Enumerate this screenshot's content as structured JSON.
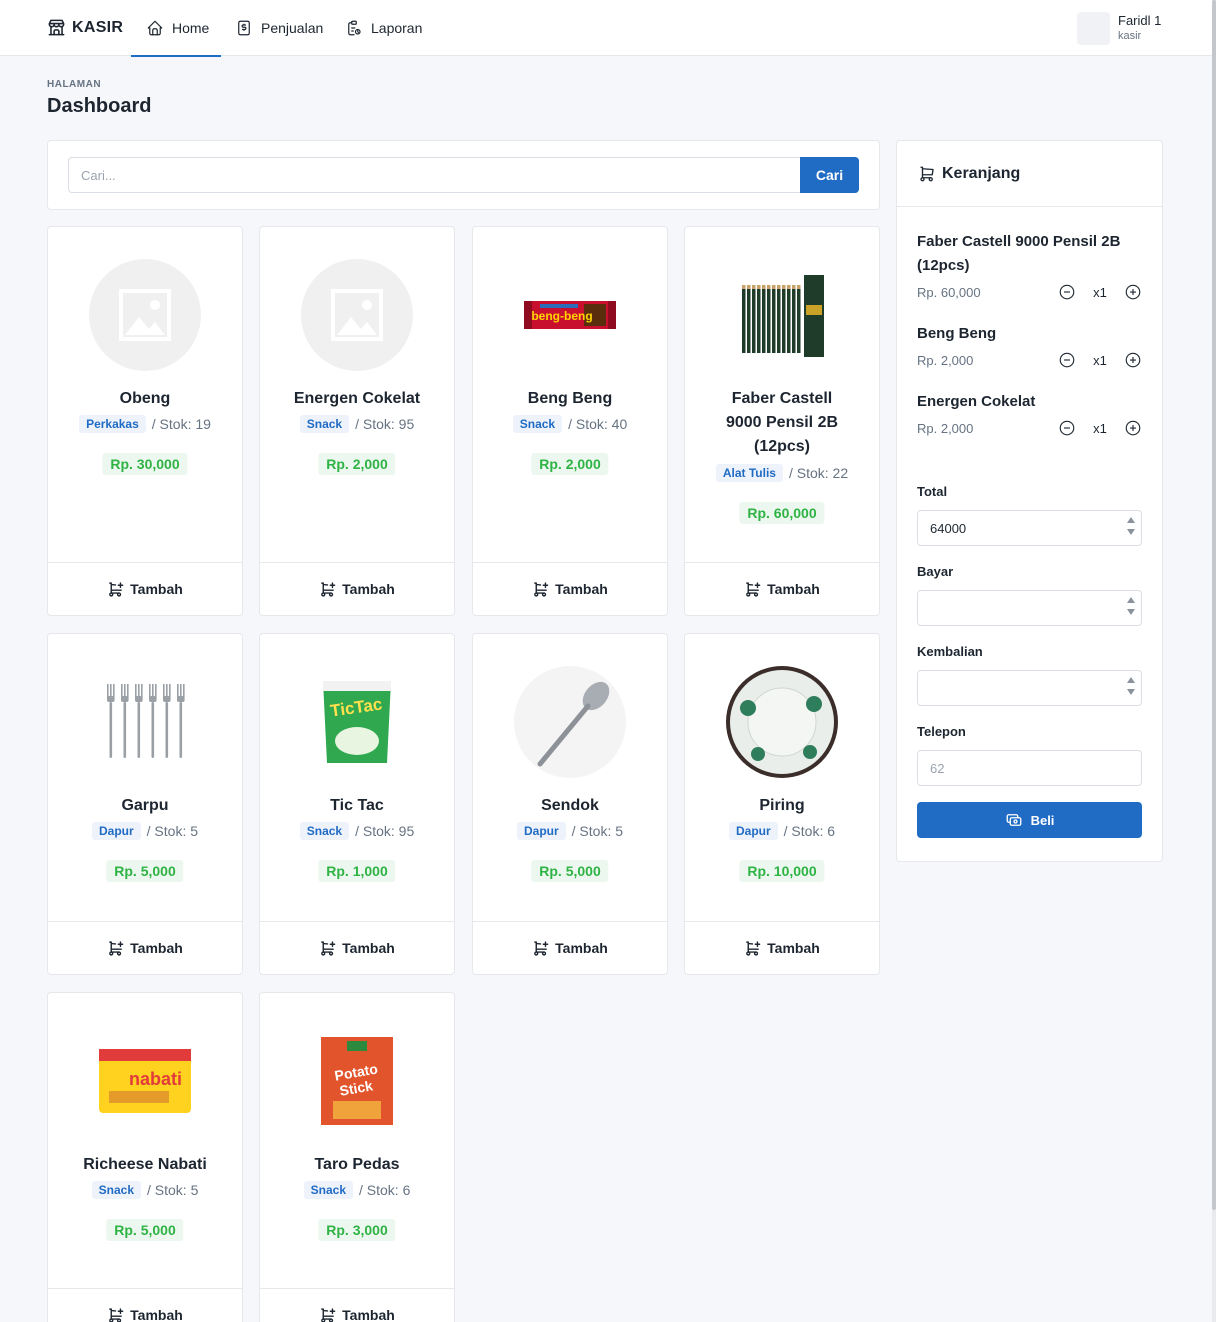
{
  "brand": {
    "name": "KASIR",
    "icon": "building-store-icon"
  },
  "nav": [
    {
      "label": "Home",
      "icon": "home-icon",
      "active": true
    },
    {
      "label": "Penjualan",
      "icon": "receipt-icon",
      "active": false
    },
    {
      "label": "Laporan",
      "icon": "clipboard-icon",
      "active": false
    }
  ],
  "user": {
    "name": "Faridl 1",
    "role": "kasir"
  },
  "page": {
    "pretitle": "HALAMAN",
    "title": "Dashboard"
  },
  "search": {
    "placeholder": "Cari...",
    "button": "Cari"
  },
  "add_label": "Tambah",
  "products": [
    {
      "name": "Obeng",
      "category": "Perkakas",
      "stock": "/ Stok: 19",
      "price": "Rp. 30,000",
      "image": "placeholder-image-icon"
    },
    {
      "name": "Energen Cokelat",
      "category": "Snack",
      "stock": "/ Stok: 95",
      "price": "Rp. 2,000",
      "image": "placeholder-image-icon"
    },
    {
      "name": "Beng Beng",
      "category": "Snack",
      "stock": "/ Stok: 40",
      "price": "Rp. 2,000",
      "image": "beng-beng-product-image"
    },
    {
      "name": "Faber Castell 9000 Pensil 2B (12pcs)",
      "category": "Alat Tulis",
      "stock": "/ Stok: 22",
      "price": "Rp. 60,000",
      "image": "pencil-set-product-image"
    },
    {
      "name": "Garpu",
      "category": "Dapur",
      "stock": "/ Stok: 5",
      "price": "Rp. 5,000",
      "image": "forks-product-image"
    },
    {
      "name": "Tic Tac",
      "category": "Snack",
      "stock": "/ Stok: 95",
      "price": "Rp. 1,000",
      "image": "tic-tac-product-image"
    },
    {
      "name": "Sendok",
      "category": "Dapur",
      "stock": "/ Stok: 5",
      "price": "Rp. 5,000",
      "image": "spoon-product-image"
    },
    {
      "name": "Piring",
      "category": "Dapur",
      "stock": "/ Stok: 6",
      "price": "Rp. 10,000",
      "image": "plate-product-image"
    },
    {
      "name": "Richeese Nabati",
      "category": "Snack",
      "stock": "/ Stok: 5",
      "price": "Rp. 5,000",
      "image": "nabati-product-image"
    },
    {
      "name": "Taro Pedas",
      "category": "Snack",
      "stock": "/ Stok: 6",
      "price": "Rp. 3,000",
      "image": "taro-product-image"
    }
  ],
  "cart": {
    "title": "Keranjang",
    "items": [
      {
        "name": "Faber Castell 9000 Pensil 2B (12pcs)",
        "price": "Rp. 60,000",
        "qty": "x1"
      },
      {
        "name": "Beng Beng",
        "price": "Rp. 2,000",
        "qty": "x1"
      },
      {
        "name": "Energen Cokelat",
        "price": "Rp. 2,000",
        "qty": "x1"
      }
    ],
    "total_label": "Total",
    "total_value": "64000",
    "bayar_label": "Bayar",
    "bayar_value": "",
    "kembalian_label": "Kembalian",
    "kembalian_value": "",
    "telepon_label": "Telepon",
    "telepon_placeholder": "62",
    "buy_label": "Beli"
  },
  "colors": {
    "primary": "#206bc4",
    "success": "#2fb344",
    "background": "#f5f7fb"
  }
}
